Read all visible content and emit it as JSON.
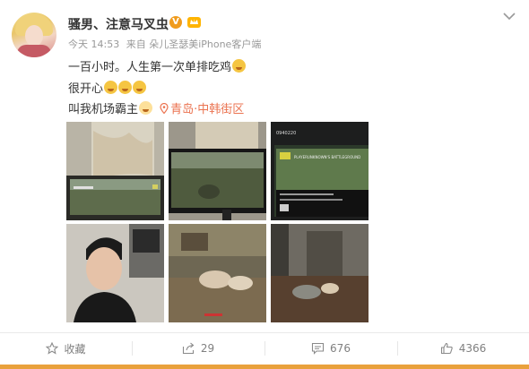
{
  "post": {
    "username": "骚男、注意马叉虫",
    "verified_badge": "V",
    "time": "今天 14:53",
    "source": "来自 朵儿圣瑟美iPhone客户端",
    "lines": {
      "line1": "一百小时。人生第一次单排吃鸡",
      "line2": "很开心",
      "line3": "叫我机场霸主"
    },
    "location": "青岛·中韩街区",
    "photo3_text": {
      "code": "0940220",
      "banner": "PLAYERUNKNOWN'S BATTLEGROUND"
    }
  },
  "actions": {
    "favorite": "收藏",
    "share_count": "29",
    "comment_count": "676",
    "like_count": "4366"
  },
  "icons": [
    "chevron-down-icon",
    "member-crown-icon",
    "location-pin-icon",
    "star-icon",
    "share-icon",
    "comment-icon",
    "like-icon"
  ],
  "colors": {
    "accent": "#eb7350",
    "verified": "#f09b1c",
    "bottom_bar": "#e9a13c"
  }
}
